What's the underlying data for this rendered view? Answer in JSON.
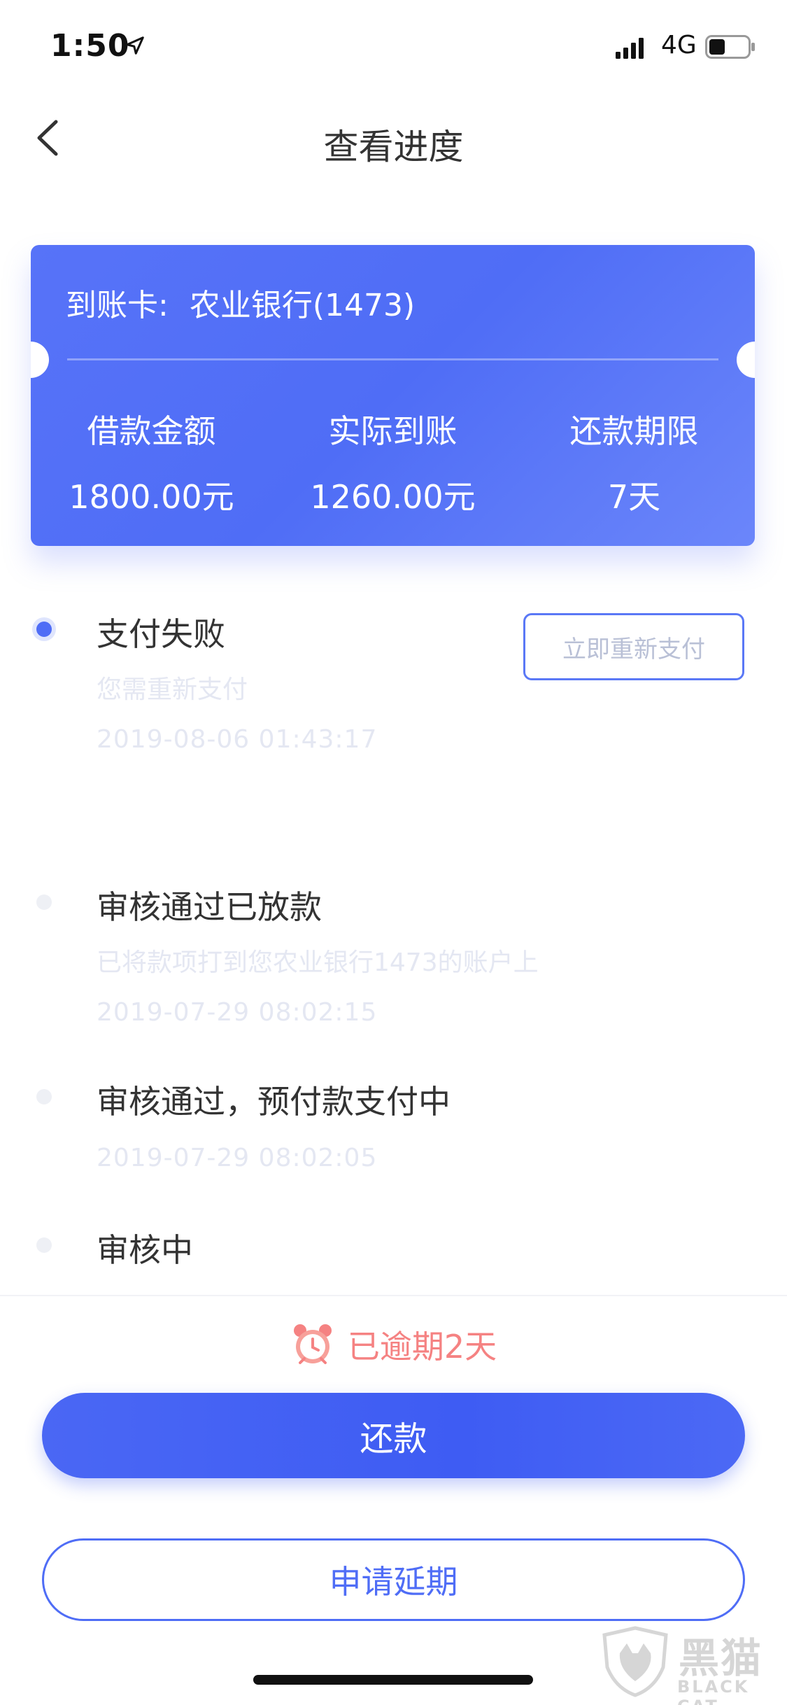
{
  "status_bar": {
    "time": "1:50",
    "network": "4G"
  },
  "nav": {
    "title": "查看进度"
  },
  "card": {
    "account_label": "到账卡:",
    "account_value": "农业银行(1473)",
    "stats": [
      {
        "label": "借款金额",
        "value": "1800.00元"
      },
      {
        "label": "实际到账",
        "value": "1260.00元"
      },
      {
        "label": "还款期限",
        "value": "7天"
      }
    ]
  },
  "timeline": {
    "items": [
      {
        "title": "支付失败",
        "desc": "您需重新支付",
        "time": "2019-08-06 01:43:17",
        "active": true
      },
      {
        "title": "审核通过已放款",
        "desc": "已将款项打到您农业银行1473的账户上",
        "time": "2019-07-29 08:02:15",
        "active": false
      },
      {
        "title": "审核通过，预付款支付中",
        "desc": "",
        "time": "2019-07-29 08:02:05",
        "active": false
      },
      {
        "title": "审核中",
        "desc": "",
        "time": "",
        "active": false
      }
    ],
    "repay_again_label": "立即重新支付"
  },
  "bottom": {
    "overdue_text": "已逾期2天",
    "repay_label": "还款",
    "extend_label": "申请延期"
  },
  "watermark": {
    "cn": "黑猫",
    "en": "BLACK CAT"
  },
  "colors": {
    "accent": "#4f6df6",
    "overdue": "#f58282"
  }
}
